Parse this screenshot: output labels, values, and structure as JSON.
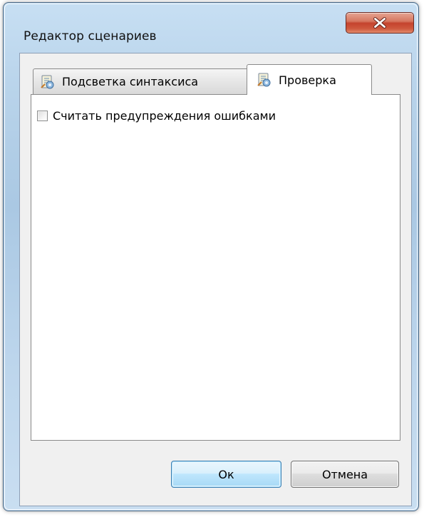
{
  "window": {
    "title": "Редактор сценариев"
  },
  "tabs": [
    {
      "label": "Подсветка синтаксиса",
      "icon": "script-settings-icon",
      "active": false
    },
    {
      "label": "Проверка",
      "icon": "script-settings-icon",
      "active": true
    }
  ],
  "panel": {
    "checkbox": {
      "label": "Считать предупреждения ошибками",
      "checked": false
    }
  },
  "buttons": {
    "ok_label": "Ок",
    "cancel_label": "Отмена"
  },
  "colors": {
    "frame": "#b8d3ea",
    "close_button": "#c4432d",
    "default_button": "#bee6fd"
  }
}
